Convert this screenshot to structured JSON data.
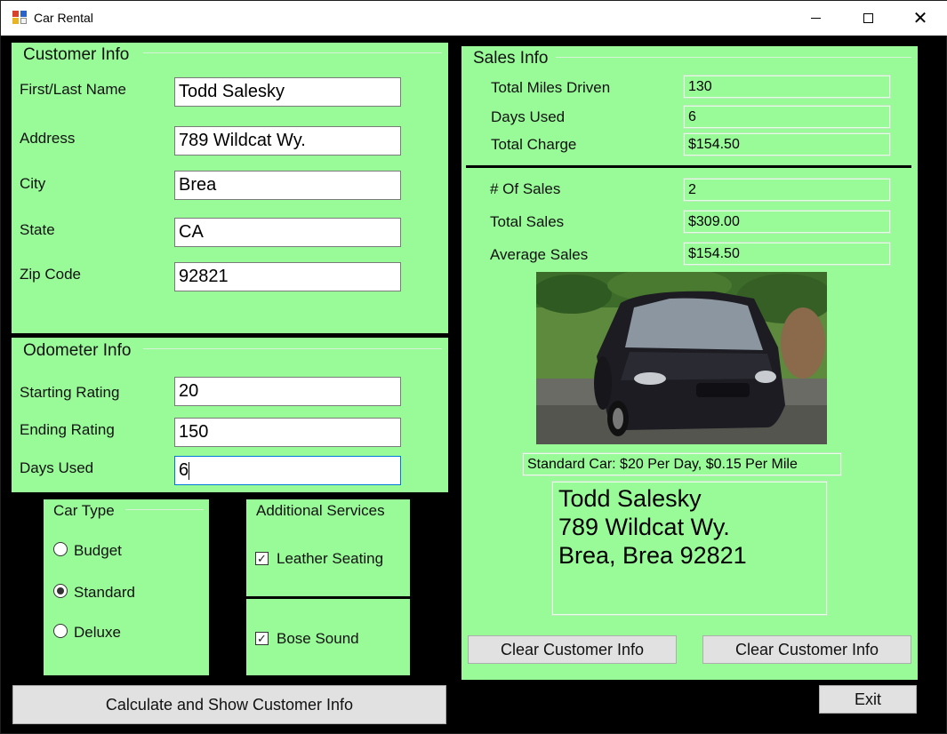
{
  "window": {
    "title": "Car Rental"
  },
  "customer": {
    "legend": "Customer Info",
    "fields": [
      {
        "label": "First/Last Name",
        "value": "Todd Salesky"
      },
      {
        "label": "Address",
        "value": "789 Wildcat Wy."
      },
      {
        "label": "City",
        "value": "Brea"
      },
      {
        "label": "State",
        "value": "CA"
      },
      {
        "label": "Zip Code",
        "value": "92821"
      }
    ]
  },
  "odometer": {
    "legend": "Odometer Info",
    "fields": [
      {
        "label": "Starting Rating",
        "value": "20"
      },
      {
        "label": "Ending Rating",
        "value": "150"
      },
      {
        "label": "Days Used",
        "value": "6"
      }
    ]
  },
  "car_type": {
    "legend": "Car Type",
    "options": [
      {
        "label": "Budget",
        "checked": false
      },
      {
        "label": "Standard",
        "checked": true
      },
      {
        "label": "Deluxe",
        "checked": false
      }
    ]
  },
  "services": {
    "legend": "Additional Services",
    "options": [
      {
        "label": "Leather Seating",
        "checked": true
      },
      {
        "label": "Bose Sound",
        "checked": true
      }
    ]
  },
  "sales": {
    "legend": "Sales Info",
    "rows": [
      {
        "label": "Total Miles Driven",
        "value": "130"
      },
      {
        "label": "Days Used",
        "value": "6"
      },
      {
        "label": "Total Charge",
        "value": "$154.50"
      },
      {
        "label": "# Of Sales",
        "value": "2"
      },
      {
        "label": "Total Sales",
        "value": "$309.00"
      },
      {
        "label": "Average Sales",
        "value": "$154.50"
      }
    ],
    "rate_text": "Standard Car: $20 Per Day, $0.15 Per Mile",
    "address_lines": [
      "Todd Salesky",
      "789 Wildcat Wy.",
      "Brea, Brea 92821"
    ]
  },
  "buttons": {
    "calculate": "Calculate and Show Customer Info",
    "clear_1": "Clear Customer Info",
    "clear_2": "Clear Customer Info",
    "exit": "Exit"
  },
  "colors": {
    "panel": "#98fb98",
    "background": "#000000"
  }
}
